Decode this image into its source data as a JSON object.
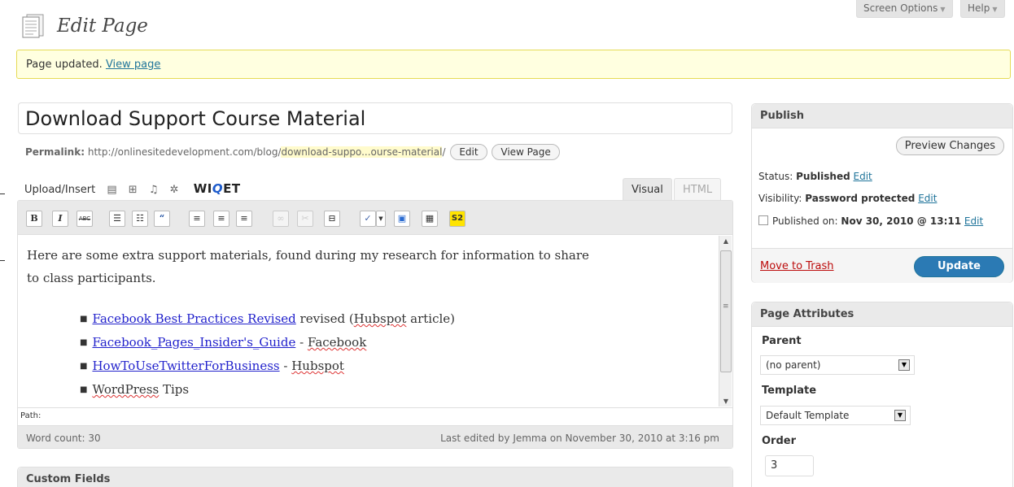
{
  "header": {
    "title": "Edit Page",
    "screen_options": "Screen Options",
    "help": "Help"
  },
  "notice": {
    "text": "Page updated.",
    "link": "View page"
  },
  "post": {
    "title": "Download Support Course Material",
    "permalink_label": "Permalink:",
    "permalink_base": "http://onlinesitedevelopment.com/blog/",
    "permalink_slug": "download-suppo...ourse-material",
    "permalink_trail": "/",
    "edit_btn": "Edit",
    "view_btn": "View Page"
  },
  "media": {
    "label": "Upload/Insert",
    "widget_prefix": "WI",
    "widget_mid": "Q",
    "widget_suffix": "ET"
  },
  "tabs": {
    "visual": "Visual",
    "html": "HTML"
  },
  "toolbar": {
    "bold": "B",
    "italic": "I",
    "strike": "ABC",
    "s2": "S2"
  },
  "content": {
    "intro_line1": "Here are some extra support materials, found during my research for information to share",
    "intro_line2": "to class participants.",
    "items": [
      {
        "link": "Facebook Best Practices Revised",
        "text_a": " revised (",
        "sq": "Hubspot",
        "text_b": " article)"
      },
      {
        "link": "Facebook_Pages_Insider's_Guide",
        "text_a": " - ",
        "sq": "Facebook",
        "text_b": ""
      },
      {
        "link": "HowToUseTwitterForBusiness",
        "text_a": " - ",
        "sq": "Hubspot",
        "text_b": ""
      },
      {
        "link": "",
        "text_a": "",
        "sq": "WordPress",
        "text_b": " Tips"
      }
    ]
  },
  "status": {
    "path": "Path:",
    "word_count": "Word count: 30",
    "last_edited": "Last edited by Jemma on November 30, 2010 at 3:16 pm"
  },
  "custom_fields": {
    "title": "Custom Fields"
  },
  "publish": {
    "title": "Publish",
    "preview": "Preview Changes",
    "status_label": "Status:",
    "status_value": "Published",
    "visibility_label": "Visibility:",
    "visibility_value": "Password protected",
    "published_label": "Published on:",
    "published_value": "Nov 30, 2010 @ 13:11",
    "edit": "Edit",
    "trash": "Move to Trash",
    "update": "Update"
  },
  "attributes": {
    "title": "Page Attributes",
    "parent_label": "Parent",
    "parent_value": "(no parent)",
    "template_label": "Template",
    "template_value": "Default Template",
    "order_label": "Order",
    "order_value": "3"
  }
}
